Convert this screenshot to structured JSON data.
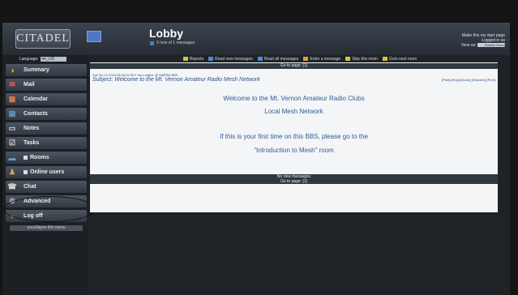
{
  "header": {
    "logo": "CITADEL",
    "room_title": "Lobby",
    "room_subtitle": "0 new of 1 messages",
    "right_lines": [
      "Make this my start page",
      "Logged in as",
      "View as:"
    ],
    "view_as_value": "Bulletin Board"
  },
  "sidebar": {
    "language_label": "Language:",
    "language_value": "en_US",
    "items": [
      {
        "label": "Summary",
        "icon": "summary-icon"
      },
      {
        "label": "Mail",
        "icon": "mail-icon"
      },
      {
        "label": "Calendar",
        "icon": "calendar-icon"
      },
      {
        "label": "Contacts",
        "icon": "contacts-icon"
      },
      {
        "label": "Notes",
        "icon": "notes-icon"
      },
      {
        "label": "Tasks",
        "icon": "tasks-icon"
      },
      {
        "label": "Rooms",
        "icon": "rooms-icon"
      },
      {
        "label": "Online users",
        "icon": "users-icon"
      },
      {
        "label": "Chat",
        "icon": "chat-icon"
      },
      {
        "label": "Advanced",
        "icon": "gear-icon"
      },
      {
        "label": "Log off",
        "icon": "logoff-icon"
      }
    ],
    "collapse_label": "uncollapse this menu"
  },
  "toolbar": {
    "items": [
      {
        "label": "Reports",
        "color": "#d8c63a"
      },
      {
        "label": "Read new messages",
        "color": "#4f8ad6"
      },
      {
        "label": "Read all messages",
        "color": "#4f8ad6"
      },
      {
        "label": "Enter a message",
        "color": "#e0a040"
      },
      {
        "label": "Skip this room",
        "color": "#d8c63a"
      },
      {
        "label": "Goto next room",
        "color": "#d8c63a"
      }
    ]
  },
  "content": {
    "top_goto": "Go to page: [1]",
    "meta": "Sat Oct 19 2019 08:00:39 EDT from w8pnr @ W8PEN-BBS",
    "subject": "Subject: Welcome to the Mt. Vernon Amateur Radio Mesh Network",
    "actions": "[Print] [Reply/Quote] [Headers] [Print]",
    "line1": "Welcome to the Mt. Vernon Amateur Radio Clubs",
    "line2": "Local Mesh Network",
    "line3": "If this is your first time on this BBS, please go to the",
    "line4": "\"Introduction to Mesh\" room",
    "no_new": "No new messages",
    "bottom_goto": "Go to page: [1]"
  },
  "colors": {
    "accent_text": "#2d5c9a",
    "bar": "#303840",
    "sidebar": "#313840"
  }
}
